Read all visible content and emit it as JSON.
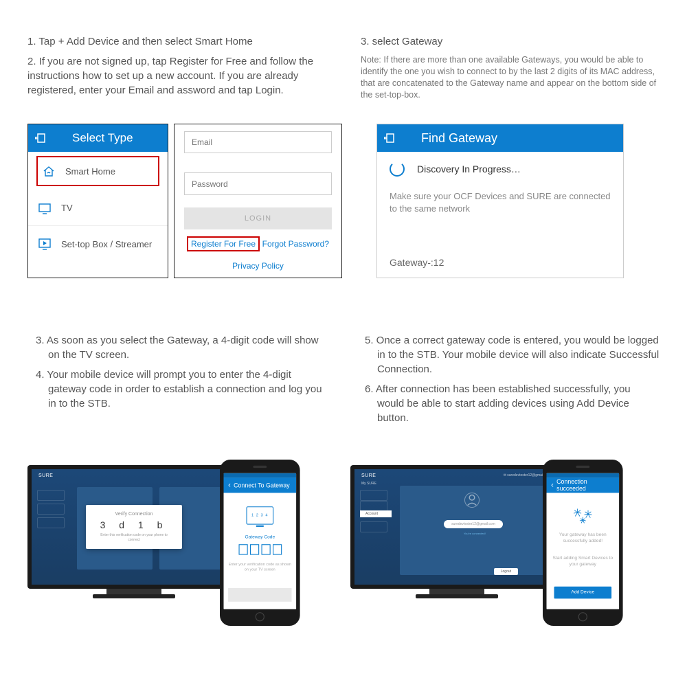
{
  "section1": {
    "left": {
      "step1": "1. Tap + Add Device and then select Smart Home",
      "step2": "2. If you are not signed up, tap Register for Free and follow the instructions how to set up a new account. If you are already registered, enter your Email and assword and tap Login."
    },
    "right": {
      "step3": "3. select Gateway",
      "note": "Note: If there are more than one available Gateways, you would be able to identify the one you wish to connect to by the last 2 digits of its MAC address, that are concatenated to the Gateway name and appear on the bottom side of the set-top-box."
    }
  },
  "select_type": {
    "title": "Select Type",
    "item1": "Smart Home",
    "item2": "TV",
    "item3": "Set-top Box / Streamer"
  },
  "login": {
    "email_ph": "Email",
    "password_ph": "Password",
    "login_btn": "LOGIN",
    "register": "Register For Free",
    "forgot": "Forgot Password?",
    "privacy": "Privacy Policy"
  },
  "gateway": {
    "title": "Find Gateway",
    "discovery": "Discovery In Progress…",
    "msg": "Make sure your OCF Devices and SURE are connected to the same network",
    "name": "Gateway-:12"
  },
  "section2": {
    "left": {
      "step3": "3.  As soon as you select the Gateway, a 4-digit code will show on the TV screen.",
      "step4": "4. Your mobile device will prompt you to enter the 4-digit gateway code in order to establish a connection and log you in to the STB."
    },
    "right": {
      "step5": "5. Once a correct gateway code is entered, you would be logged in to the STB. Your mobile device will also indicate Successful Connection.",
      "step6": "6. After connection has been established successfully, you would be able to start adding devices using Add Device button."
    }
  },
  "tv1": {
    "brand": "SURE",
    "dialog_title": "Verify Connection",
    "code": "3 d 1 b",
    "dialog_sub": "Enter this verification code on your phone to connect"
  },
  "phone1": {
    "title": "Connect To Gateway",
    "monitor_code": "1 2 3 4",
    "gc_label": "Gateway Code",
    "hint": "Enter your verification code as shown on your TV screen"
  },
  "tv2": {
    "brand": "SURE",
    "user": "My SURE",
    "account": "Account",
    "email_top": "suredevtester12@gmail.com",
    "email": "suredevtester12@gmail.com",
    "connected": "You're connected!",
    "logout": "Logout"
  },
  "phone2": {
    "title": "Connection succeeded",
    "msg1": "Your gateway has been successfully added!",
    "msg2": "Start adding Smart Devices to your gateway",
    "add_btn": "Add Device"
  }
}
